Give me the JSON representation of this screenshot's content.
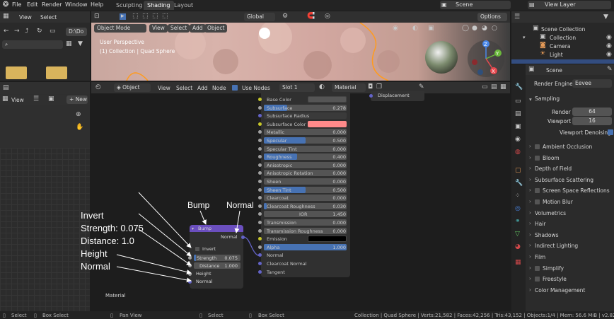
{
  "menu": [
    "File",
    "Edit",
    "Render",
    "Window",
    "Help"
  ],
  "workspace_tabs": [
    "Sculpting",
    "Shading",
    "Layout"
  ],
  "active_tab": "Shading",
  "scene_field": "Scene",
  "view_layer_field": "View Layer",
  "file_browser": {
    "view": "View",
    "select": "Select",
    "path_label": "D:\\Do"
  },
  "image_editor": {
    "view": "View",
    "new_btn": "New"
  },
  "viewport": {
    "mode": "Object Mode",
    "menus": [
      "View",
      "Select",
      "Add",
      "Object"
    ],
    "orientation": "Global",
    "options": "Options",
    "info_line1": "User Perspective",
    "info_line2": "(1) Collection | Quad Sphere",
    "gizmo": {
      "z": "Z",
      "y": "Y",
      "x": "X"
    }
  },
  "outliner": {
    "title": "Scene Collection",
    "items": [
      "Collection",
      "Camera",
      "Light"
    ]
  },
  "node_editor": {
    "type": "Object",
    "menus": [
      "View",
      "Select",
      "Add",
      "Node"
    ],
    "use_nodes": "Use Nodes",
    "slot": "Slot 1",
    "material": "Material",
    "displacement": "Displacement",
    "frame_label": "Material"
  },
  "bsdf_rows": [
    {
      "name": "Base Color",
      "type": "color",
      "color": "#555555"
    },
    {
      "name": "Subsurface",
      "value": "0.278",
      "fill": 0.28
    },
    {
      "name": "Subsurface Radius",
      "type": "dropdown"
    },
    {
      "name": "Subsurface Color",
      "type": "color",
      "color": "#ff8a8a"
    },
    {
      "name": "Metallic",
      "value": "0.000",
      "fill": 0
    },
    {
      "name": "Specular",
      "value": "0.500",
      "fill": 0.5
    },
    {
      "name": "Specular Tint",
      "value": "0.000",
      "fill": 0
    },
    {
      "name": "Roughness",
      "value": "0.400",
      "fill": 0.4
    },
    {
      "name": "Anisotropic",
      "value": "0.000",
      "fill": 0
    },
    {
      "name": "Anisotropic Rotation",
      "value": "0.000",
      "fill": 0
    },
    {
      "name": "Sheen",
      "value": "0.000",
      "fill": 0
    },
    {
      "name": "Sheen Tint",
      "value": "0.500",
      "fill": 0.5
    },
    {
      "name": "Clearcoat",
      "value": "0.000",
      "fill": 0
    },
    {
      "name": "Clearcoat Roughness",
      "value": "0.030",
      "fill": 0.03
    },
    {
      "name": "IOR",
      "value": "1.450",
      "fill": 0,
      "center": true
    },
    {
      "name": "Transmission",
      "value": "0.000",
      "fill": 0
    },
    {
      "name": "Transmission Roughness",
      "value": "0.000",
      "fill": 0
    },
    {
      "name": "Emission",
      "type": "color",
      "color": "#000000"
    },
    {
      "name": "Alpha",
      "value": "1.000",
      "fill": 1
    },
    {
      "name": "Normal",
      "type": "socket"
    },
    {
      "name": "Clearcoat Normal",
      "type": "socket"
    },
    {
      "name": "Tangent",
      "type": "socket"
    }
  ],
  "bump_node": {
    "title": "Bump",
    "output": "Normal",
    "invert": "Invert",
    "strength_label": "Strength",
    "strength_value": "0.075",
    "distance_label": "Distance",
    "distance_value": "1.000",
    "height": "Height",
    "normal": "Normal"
  },
  "annotations": {
    "bump": "Bump",
    "normal_top": "Normal",
    "invert": "Invert",
    "strength": "Strength: 0.075",
    "distance": "Distance: 1.0",
    "height": "Height",
    "normal": "Normal"
  },
  "properties": {
    "scene_title": "Scene",
    "render_engine_label": "Render Engine",
    "render_engine_value": "Eevee",
    "sampling": "Sampling",
    "render_label": "Render",
    "render_value": "64",
    "viewport_label": "Viewport",
    "viewport_value": "16",
    "viewport_denoising": "Viewport Denoising",
    "sections": [
      {
        "label": "Ambient Occlusion",
        "checkbox": true
      },
      {
        "label": "Bloom",
        "checkbox": true
      },
      {
        "label": "Depth of Field",
        "checkbox": false
      },
      {
        "label": "Subsurface Scattering",
        "checkbox": false
      },
      {
        "label": "Screen Space Reflections",
        "checkbox": true
      },
      {
        "label": "Motion Blur",
        "checkbox": true
      },
      {
        "label": "Volumetrics",
        "checkbox": false
      },
      {
        "label": "Hair",
        "checkbox": false
      },
      {
        "label": "Shadows",
        "checkbox": false
      },
      {
        "label": "Indirect Lighting",
        "checkbox": false
      },
      {
        "label": "Film",
        "checkbox": false
      },
      {
        "label": "Simplify",
        "checkbox": true
      },
      {
        "label": "Freestyle",
        "checkbox": true
      },
      {
        "label": "Color Management",
        "checkbox": false
      }
    ]
  },
  "status_bar": {
    "select": "Select",
    "box_select": "Box Select",
    "pan_view": "Pan View",
    "select2": "Select",
    "box_select2": "Box Select",
    "stats": "Collection | Quad Sphere | Verts:21,582 | Faces:42,256 | Tris:43,152 | Objects:1/4 | Mem: 56.6 MiB | v2.82.7"
  },
  "colors": {
    "accent": "#4772b3",
    "node_header": "#6b4fbf",
    "selection": "#ff9b1f",
    "shader_socket": "#63c763",
    "vector_socket": "#6363c7",
    "float_socket": "#a1a1a1",
    "color_socket": "#c7c729"
  }
}
